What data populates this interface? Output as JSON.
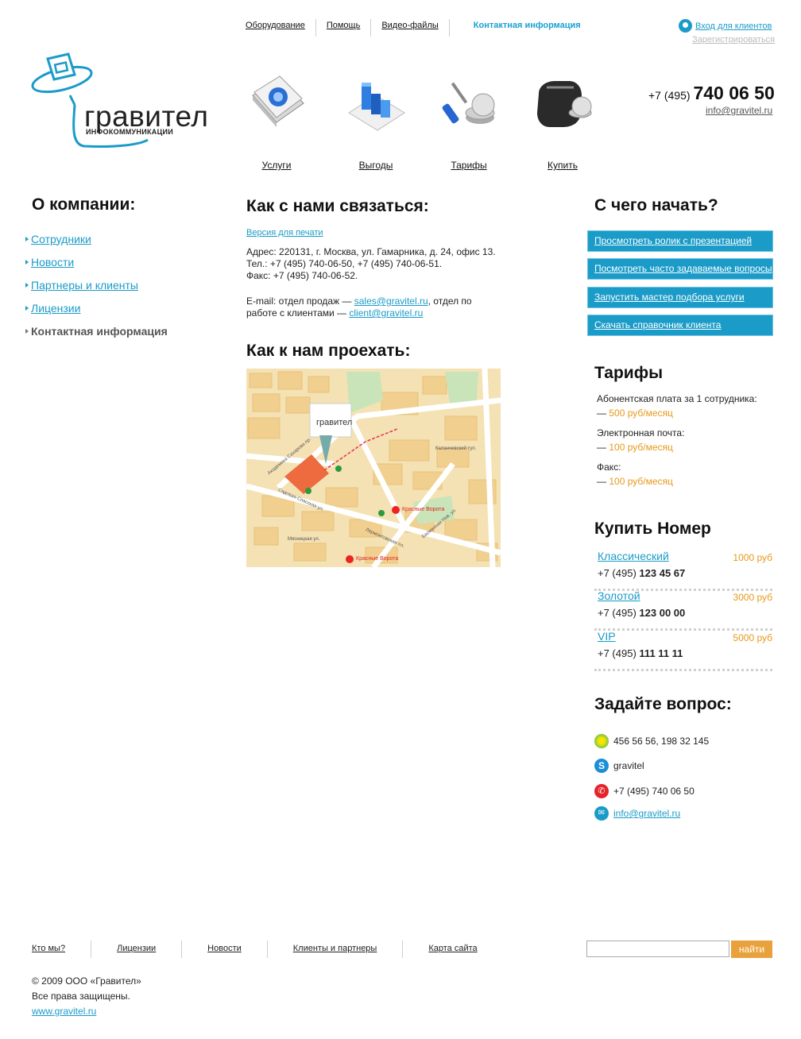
{
  "topnav": {
    "items": [
      "Оборудование",
      "Помощь",
      "Видео-файлы"
    ],
    "active": "Контактная информация"
  },
  "login": {
    "label": "Вход для клиентов",
    "register": "Зарегистрироваться"
  },
  "logo": {
    "name": "гравител",
    "subtitle": "ИНФОКОММУНИКАЦИИ"
  },
  "services": [
    "Услуги",
    "Выгоды",
    "Тарифы",
    "Купить"
  ],
  "header_contact": {
    "prefix": "+7 (495)",
    "number": "740 06 50",
    "email": "info@gravitel.ru"
  },
  "left": {
    "title": "О компании:",
    "items": [
      "Сотрудники",
      "Новости",
      "Партнеры и клиенты",
      "Лицензии"
    ],
    "current": "Контактная информация"
  },
  "center": {
    "title": "Как с нами связаться:",
    "print": "Версия для печати",
    "address": "Адрес: 220131, г. Москва, ул. Гамарника, д. 24, офис 13.",
    "tel": "Тел.: +7 (495) 740-06-50, +7 (495) 740-06-51.",
    "fax": "Факс: +7 (495) 740-06-52.",
    "email_prefix": "E-mail: отдел продаж — ",
    "sales": "sales@gravitel.ru",
    "email_mid": ", отдел по работе с клиентами — ",
    "client": "client@gravitel.ru",
    "title2": "Как к нам проехать:",
    "map": {
      "brand": "гравител",
      "metro": "Красные Ворота",
      "streets": [
        "Садовая-Спасская ул.",
        "Академика Сахарова пр.",
        "Мясницкая ул.",
        "Лермонтовская пл.",
        "Басманная Нов. ул.",
        "Каланчевский туп."
      ]
    }
  },
  "right": {
    "start_title": "С чего начать?",
    "ctas": [
      "Просмотреть ролик с презентацией",
      "Посмотреть часто задаваемые вопросы",
      "Запустить мастер подбора услуги",
      "Скачать справочник клиента"
    ],
    "tariffs_title": "Тарифы",
    "tariffs": [
      {
        "label": "Абонентская плата за 1 сотрудника:",
        "price": "500 руб/месяц"
      },
      {
        "label": "Электронная почта:",
        "price": "100 руб/месяц"
      },
      {
        "label": "Факс:",
        "price": "100 руб/месяц"
      }
    ],
    "buy_title": "Купить Номер",
    "numbers": [
      {
        "name": "Классический",
        "price": "1000 руб",
        "prefix": "+7 (495)",
        "number": "123 45 67"
      },
      {
        "name": "Золотой",
        "price": "3000 руб",
        "prefix": "+7 (495)",
        "number": "123 00 00"
      },
      {
        "name": "VIP",
        "price": "5000 руб",
        "prefix": "+7 (495)",
        "number": "111 11 11"
      }
    ],
    "ask_title": "Задайте вопрос:",
    "contacts": [
      {
        "icon": "icq-icon",
        "text": "456 56 56, 198 32 145"
      },
      {
        "icon": "skype-icon",
        "text": "gravitel"
      },
      {
        "icon": "phone-icon",
        "text": "+7 (495) 740 06 50"
      },
      {
        "icon": "email-icon",
        "text": "info@gravitel.ru"
      }
    ]
  },
  "footer": {
    "nav": [
      "Кто мы?",
      "Лицензии",
      "Новости",
      "Клиенты и партнеры",
      "Карта сайта"
    ],
    "search_button": "найти",
    "copyright": "© 2009 ООО «Гравител»",
    "rights": "Все права защищены.",
    "site": "www.gravitel.ru"
  }
}
